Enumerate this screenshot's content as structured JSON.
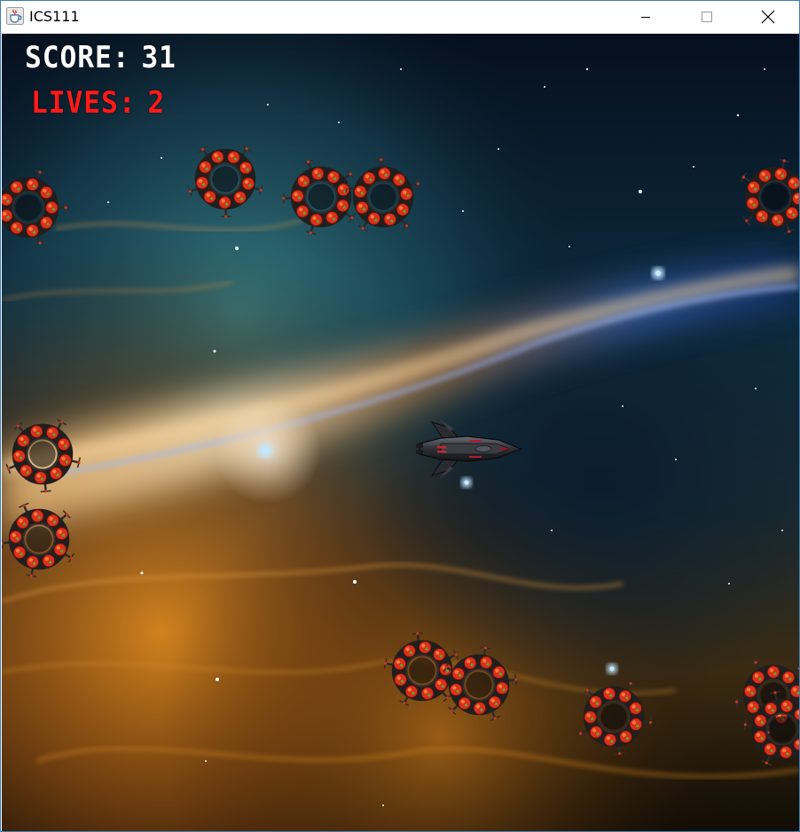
{
  "window": {
    "title": "ICS111",
    "app_icon": "java-cup-icon",
    "controls": {
      "minimize_icon": "minimize-icon",
      "maximize_icon": "maximize-icon",
      "close_icon": "close-icon"
    }
  },
  "hud": {
    "score_label": "SCORE:",
    "score_value": "31",
    "lives_label": "LIVES:",
    "lives_value": "2",
    "score_color": "#ffffff",
    "lives_color": "#ff1a1a"
  },
  "scene": {
    "background": "space-nebula",
    "player": "player-starship",
    "enemy": "red-spiked-ring-mine",
    "enemy_count": 13
  }
}
